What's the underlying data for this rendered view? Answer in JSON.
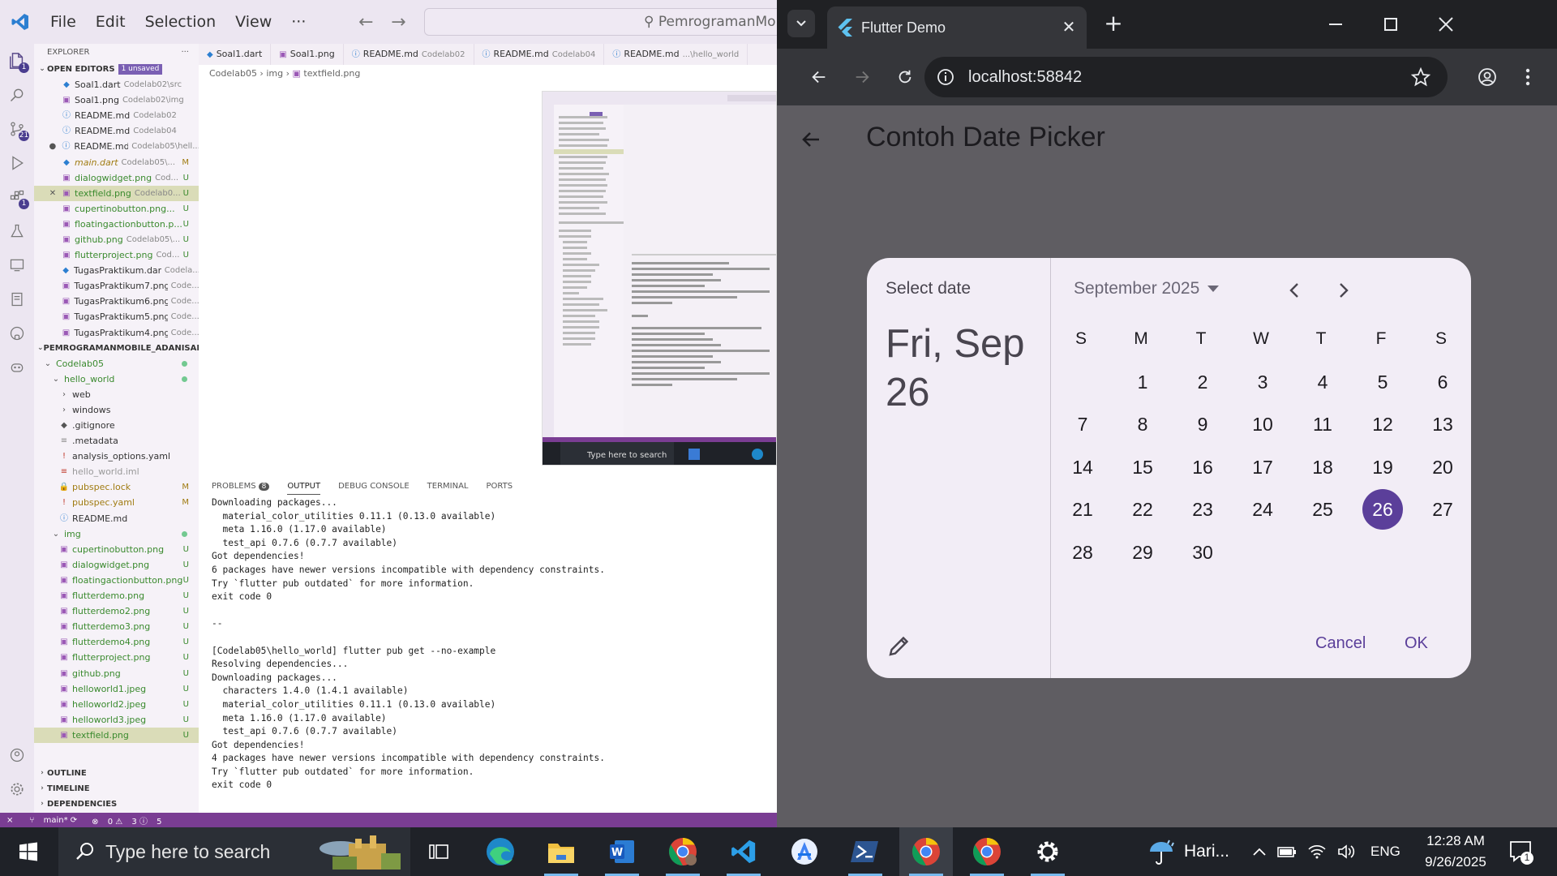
{
  "vscode": {
    "menu": [
      "File",
      "Edit",
      "Selection",
      "View",
      "···"
    ],
    "search_text": "PemrogramanMo",
    "activity_badges": {
      "source_control": "21",
      "extensions": "1",
      "explorer": "1"
    },
    "explorer_title": "EXPLORER",
    "open_editors": {
      "title": "OPEN EDITORS",
      "badge": "1 unsaved",
      "items": [
        {
          "name": "Soal1.dart",
          "desc": "Codelab02\\src",
          "status": "",
          "icon": "dart"
        },
        {
          "name": "Soal1.png",
          "desc": "Codelab02\\img",
          "status": "",
          "icon": "image"
        },
        {
          "name": "README.md",
          "desc": "Codelab02",
          "status": "",
          "icon": "info"
        },
        {
          "name": "README.md",
          "desc": "Codelab04",
          "status": "",
          "icon": "info"
        },
        {
          "name": "README.md",
          "desc": "Codelab05\\hell...",
          "status": "",
          "icon": "info"
        },
        {
          "name": "main.dart",
          "desc": "Codelab05\\...",
          "status": "M",
          "icon": "dart"
        },
        {
          "name": "dialogwidget.png",
          "desc": "Cod...",
          "status": "U",
          "icon": "image"
        },
        {
          "name": "textfield.png",
          "desc": "Codelab0...",
          "status": "U",
          "icon": "image"
        },
        {
          "name": "cupertinobutton.png...",
          "desc": "",
          "status": "U",
          "icon": "image"
        },
        {
          "name": "floatingactionbutton.p...",
          "desc": "",
          "status": "U",
          "icon": "image"
        },
        {
          "name": "github.png",
          "desc": "Codelab05\\...",
          "status": "U",
          "icon": "image"
        },
        {
          "name": "flutterproject.png",
          "desc": "Cod...",
          "status": "U",
          "icon": "image"
        },
        {
          "name": "TugasPraktikum.dart",
          "desc": "Codela...",
          "status": "",
          "icon": "dart"
        },
        {
          "name": "TugasPraktikum7.png",
          "desc": "Code...",
          "status": "",
          "icon": "image"
        },
        {
          "name": "TugasPraktikum6.png",
          "desc": "Code...",
          "status": "",
          "icon": "image"
        },
        {
          "name": "TugasPraktikum5.png",
          "desc": "Code...",
          "status": "",
          "icon": "image"
        },
        {
          "name": "TugasPraktikum4.png",
          "desc": "Code...",
          "status": "",
          "icon": "image"
        }
      ]
    },
    "workspace": {
      "title": "PEMROGRAMANMOBILE_ADANISALSA...",
      "tree": [
        {
          "name": "Codelab05",
          "depth": 0,
          "type": "folder-open",
          "status": "dot"
        },
        {
          "name": "hello_world",
          "depth": 1,
          "type": "folder-open",
          "status": "dot"
        },
        {
          "name": "web",
          "depth": 2,
          "type": "folder",
          "status": ""
        },
        {
          "name": "windows",
          "depth": 2,
          "type": "folder",
          "status": ""
        },
        {
          "name": ".gitignore",
          "depth": 2,
          "type": "git",
          "status": ""
        },
        {
          "name": ".metadata",
          "depth": 2,
          "type": "file",
          "status": ""
        },
        {
          "name": "analysis_options.yaml",
          "depth": 2,
          "type": "yaml",
          "status": ""
        },
        {
          "name": "hello_world.iml",
          "depth": 2,
          "type": "iml",
          "status": ""
        },
        {
          "name": "pubspec.lock",
          "depth": 2,
          "type": "lock",
          "status": "M"
        },
        {
          "name": "pubspec.yaml",
          "depth": 2,
          "type": "yaml",
          "status": "M"
        },
        {
          "name": "README.md",
          "depth": 2,
          "type": "info",
          "status": ""
        },
        {
          "name": "img",
          "depth": 1,
          "type": "folder-open",
          "status": "dot"
        },
        {
          "name": "cupertinobutton.png",
          "depth": 2,
          "type": "image",
          "status": "U"
        },
        {
          "name": "dialogwidget.png",
          "depth": 2,
          "type": "image",
          "status": "U"
        },
        {
          "name": "floatingactionbutton.png",
          "depth": 2,
          "type": "image",
          "status": "U"
        },
        {
          "name": "flutterdemo.png",
          "depth": 2,
          "type": "image",
          "status": "U"
        },
        {
          "name": "flutterdemo2.png",
          "depth": 2,
          "type": "image",
          "status": "U"
        },
        {
          "name": "flutterdemo3.png",
          "depth": 2,
          "type": "image",
          "status": "U"
        },
        {
          "name": "flutterdemo4.png",
          "depth": 2,
          "type": "image",
          "status": "U"
        },
        {
          "name": "flutterproject.png",
          "depth": 2,
          "type": "image",
          "status": "U"
        },
        {
          "name": "github.png",
          "depth": 2,
          "type": "image",
          "status": "U"
        },
        {
          "name": "helloworld1.jpeg",
          "depth": 2,
          "type": "image",
          "status": "U"
        },
        {
          "name": "helloworld2.jpeg",
          "depth": 2,
          "type": "image",
          "status": "U"
        },
        {
          "name": "helloworld3.jpeg",
          "depth": 2,
          "type": "image",
          "status": "U"
        },
        {
          "name": "textfield.png",
          "depth": 2,
          "type": "image",
          "status": "U"
        }
      ]
    },
    "bottom_sections": [
      "OUTLINE",
      "TIMELINE",
      "DEPENDENCIES"
    ],
    "tabs": [
      {
        "name": "Soal1.dart",
        "desc": ""
      },
      {
        "name": "Soal1.png",
        "desc": ""
      },
      {
        "name": "README.md",
        "desc": "Codelab02"
      },
      {
        "name": "README.md",
        "desc": "Codelab04"
      },
      {
        "name": "README.md",
        "desc": "...\\hello_world"
      }
    ],
    "breadcrumb": [
      "Codelab05",
      "img",
      "textfield.png"
    ],
    "panel_tabs": [
      "PROBLEMS",
      "OUTPUT",
      "DEBUG CONSOLE",
      "TERMINAL",
      "PORTS"
    ],
    "problems_count": "8",
    "output_lines": [
      "Downloading packages...",
      "  material_color_utilities 0.11.1 (0.13.0 available)",
      "  meta 1.16.0 (1.17.0 available)",
      "  test_api 0.7.6 (0.7.7 available)",
      "Got dependencies!",
      "6 packages have newer versions incompatible with dependency constraints.",
      "Try `flutter pub outdated` for more information.",
      "exit code 0",
      "",
      "--",
      "",
      "[Codelab05\\hello_world] flutter pub get --no-example",
      "Resolving dependencies...",
      "Downloading packages...",
      "  characters 1.4.0 (1.4.1 available)",
      "  material_color_utilities 0.11.1 (0.13.0 available)",
      "  meta 1.16.0 (1.17.0 available)",
      "  test_api 0.7.6 (0.7.7 available)",
      "Got dependencies!",
      "4 packages have newer versions incompatible with dependency constraints.",
      "Try `flutter pub outdated` for more information.",
      "exit code 0"
    ],
    "status": {
      "branch": "main*",
      "errors": "0",
      "warnings": "3",
      "info": "5"
    },
    "preview_search": "Type here to search"
  },
  "chrome": {
    "tab_title": "Flutter Demo",
    "url": "localhost:58842"
  },
  "app": {
    "title": "Contoh Date Picker"
  },
  "datepicker": {
    "label": "Select date",
    "selected_display": "Fri, Sep 26",
    "month_label": "September 2025",
    "weekdays": [
      "S",
      "M",
      "T",
      "W",
      "T",
      "F",
      "S"
    ],
    "first_weekday_offset": 1,
    "days_in_month": 30,
    "selected_day": 26,
    "cancel": "Cancel",
    "ok": "OK",
    "accent": "#5b3f9a"
  },
  "taskbar": {
    "search_placeholder": "Type here to search",
    "weather": "Hari...",
    "language": "ENG",
    "time": "12:28 AM",
    "date": "9/26/2025",
    "notification_count": "1"
  }
}
